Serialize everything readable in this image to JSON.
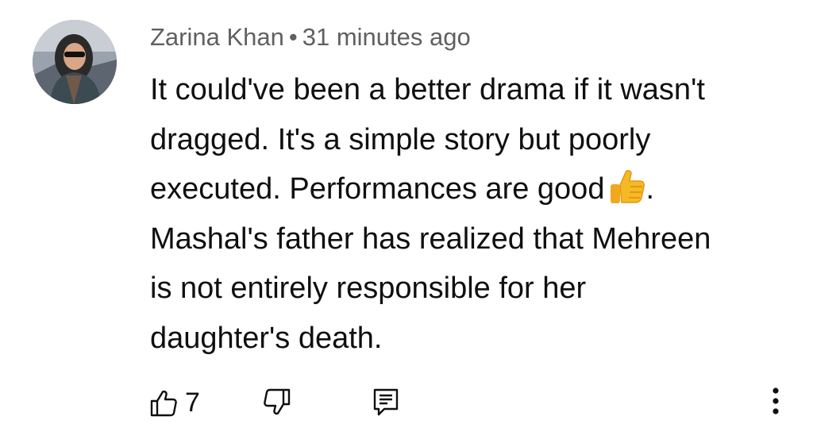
{
  "comment": {
    "author": "Zarina Khan",
    "separator": "•",
    "time": "31 minutes ago",
    "lines": [
      "It could've been a better drama if it wasn't",
      "dragged. It's a simple story but poorly",
      "executed. Performances are good",
      "Mashal's father has realized that Mehreen",
      "is not entirely responsible for her",
      "daughter's death."
    ],
    "line3_suffix": ".",
    "emoji": "thumbs-up-emoji",
    "likes": "7"
  },
  "icons": {
    "like": "thumbs-up-icon",
    "dislike": "thumbs-down-icon",
    "reply": "reply-icon",
    "more": "more-vert-icon"
  },
  "colors": {
    "text": "#0f0f0f",
    "meta": "#606060",
    "emoji": "#f6b926"
  }
}
